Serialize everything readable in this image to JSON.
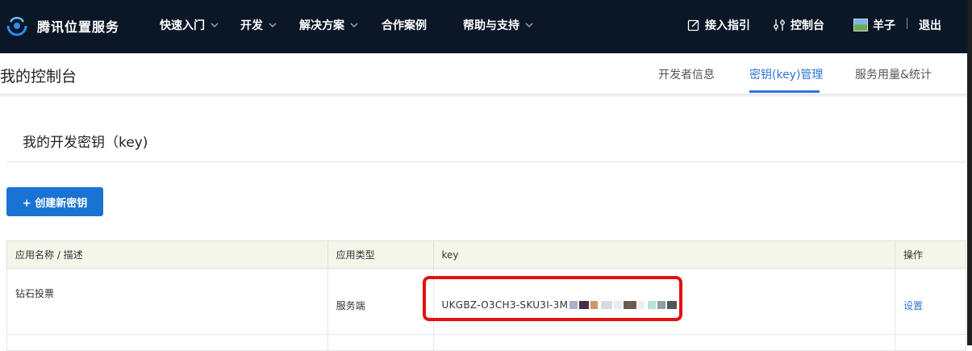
{
  "nav": {
    "brand": "腾讯位置服务",
    "items": [
      {
        "label": "快速入门",
        "has_dropdown": true
      },
      {
        "label": "开发",
        "has_dropdown": true
      },
      {
        "label": "解决方案",
        "has_dropdown": true
      },
      {
        "label": "合作案例",
        "has_dropdown": false
      },
      {
        "label": "帮助与支持",
        "has_dropdown": true
      }
    ],
    "access_guide": "接入指引",
    "console": "控制台",
    "user": "羊子",
    "logout": "退出"
  },
  "subheader": {
    "title": "我的控制台",
    "tabs": [
      {
        "label": "开发者信息",
        "active": false
      },
      {
        "label": "密钥(key)管理",
        "active": true
      },
      {
        "label": "服务用量&统计",
        "active": false
      }
    ]
  },
  "main": {
    "section_title": "我的开发密钥（key)",
    "create_button": "+ 创建新密钥",
    "table": {
      "headers": [
        "应用名称 / 描述",
        "应用类型",
        "key",
        "操作"
      ],
      "rows": [
        {
          "name": "钻石投票",
          "type": "服务端",
          "key_visible": "UKGBZ-O3CH3-SKU3I-3M",
          "action": "设置"
        }
      ]
    }
  },
  "colors": {
    "nav_bg": "#0b1626",
    "accent": "#2e74d6",
    "button": "#1973d2",
    "highlight_box": "#e51010"
  }
}
